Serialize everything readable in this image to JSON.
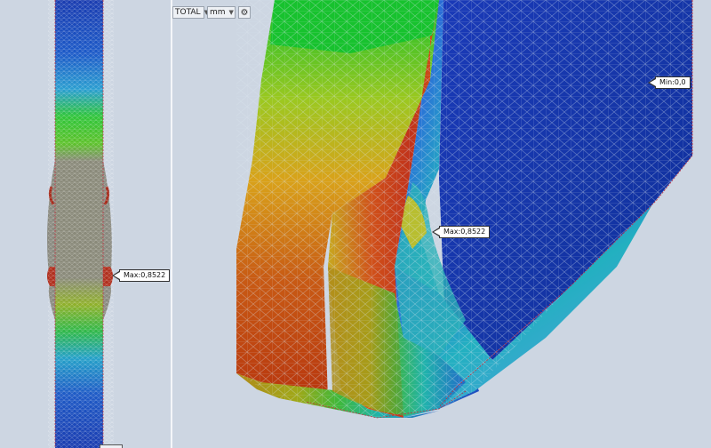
{
  "toolbar": {
    "component": "TOTAL",
    "unit": "mm"
  },
  "icons": {
    "dropdown": "chevron-down-icon",
    "settings": "gear-icon"
  },
  "probes": {
    "left_max": "Max:0,8522",
    "right_max": "Max:0,8522",
    "right_min": "Min:0,0"
  },
  "colors": {
    "background": "#cdd6e2",
    "max": "#c0281a",
    "min": "#0a2aa0"
  }
}
